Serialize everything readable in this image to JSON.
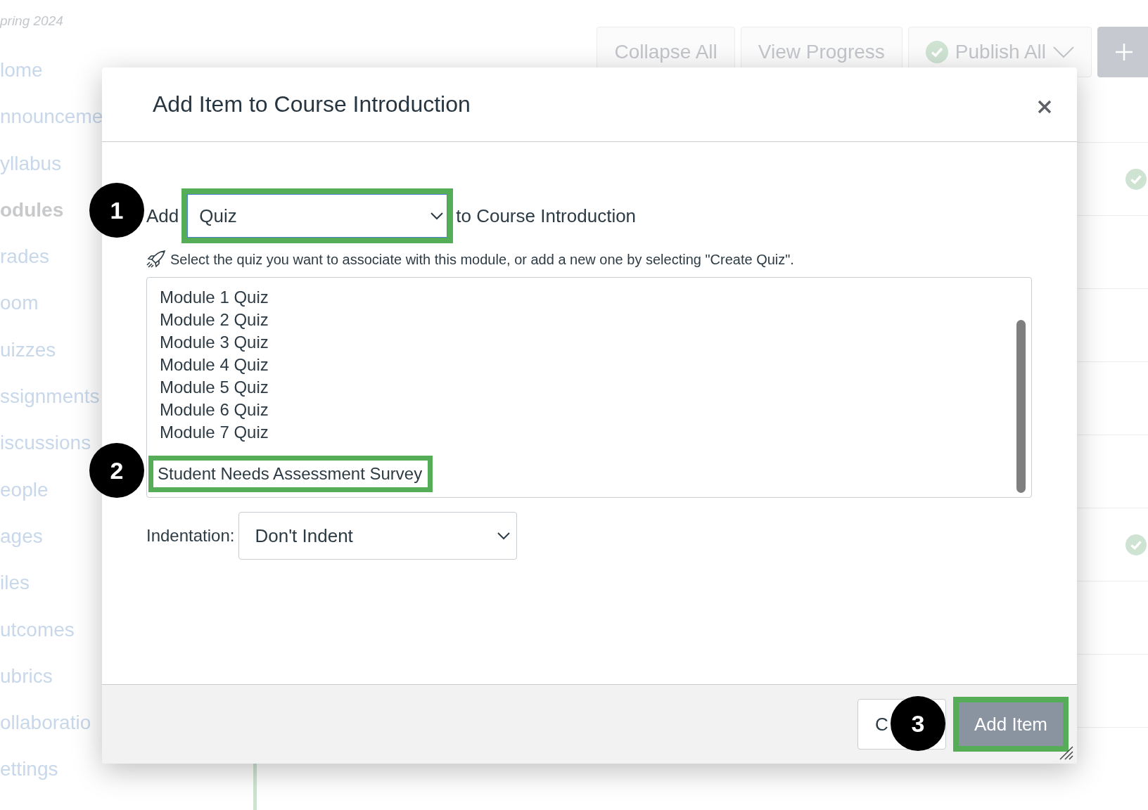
{
  "course_term": "pring 2024",
  "sidebar": {
    "items": [
      {
        "label": "lome",
        "selected": false
      },
      {
        "label": "nnounceme",
        "selected": false
      },
      {
        "label": "yllabus",
        "selected": false
      },
      {
        "label": "odules",
        "selected": true
      },
      {
        "label": "rades",
        "selected": false
      },
      {
        "label": "oom",
        "selected": false
      },
      {
        "label": "uizzes",
        "selected": false
      },
      {
        "label": "ssignments",
        "selected": false
      },
      {
        "label": "iscussions",
        "selected": false
      },
      {
        "label": "eople",
        "selected": false
      },
      {
        "label": "ages",
        "selected": false
      },
      {
        "label": "iles",
        "selected": false
      },
      {
        "label": "utcomes",
        "selected": false
      },
      {
        "label": "ubrics",
        "selected": false
      },
      {
        "label": "ollaboratio",
        "selected": false
      },
      {
        "label": "ettings",
        "selected": false
      }
    ]
  },
  "toolbar": {
    "buttons": [
      {
        "kind": "text",
        "label": "Collapse All"
      },
      {
        "kind": "text",
        "label": "View Progress"
      },
      {
        "kind": "publish",
        "label": "Publish All"
      },
      {
        "kind": "add"
      }
    ]
  },
  "module_rows": [
    {
      "published": true
    },
    {
      "published": false
    },
    {
      "published": false
    },
    {
      "published": false
    },
    {
      "published": false
    },
    {
      "published": true
    },
    {
      "published": false
    },
    {
      "published": false
    },
    {
      "published": false
    }
  ],
  "dialog": {
    "title": "Add Item to Course Introduction",
    "add_label": "Add",
    "type_select": {
      "value": "Quiz",
      "highlighted": true
    },
    "target_label": "to Course Introduction",
    "hint": "Select the quiz you want to associate with this module, or add a new one by selecting \"Create Quiz\".",
    "items": [
      {
        "label": "Module 1 Quiz",
        "selected": false
      },
      {
        "label": "Module 2 Quiz",
        "selected": false
      },
      {
        "label": "Module 3 Quiz",
        "selected": false
      },
      {
        "label": "Module 4 Quiz",
        "selected": false
      },
      {
        "label": "Module 5 Quiz",
        "selected": false
      },
      {
        "label": "Module 6 Quiz",
        "selected": false
      },
      {
        "label": "Module 7 Quiz",
        "selected": false
      },
      {
        "label": "Student Needs Assessment Survey",
        "selected": true
      }
    ],
    "indentation": {
      "label": "Indentation:",
      "value": "Don't Indent"
    },
    "buttons": [
      {
        "kind": "cancel",
        "label": "C",
        "highlighted": false
      },
      {
        "kind": "primary",
        "label": "Add Item",
        "highlighted": true
      }
    ]
  },
  "annotations": [
    {
      "label": "1"
    },
    {
      "label": "2"
    },
    {
      "label": "3"
    }
  ]
}
